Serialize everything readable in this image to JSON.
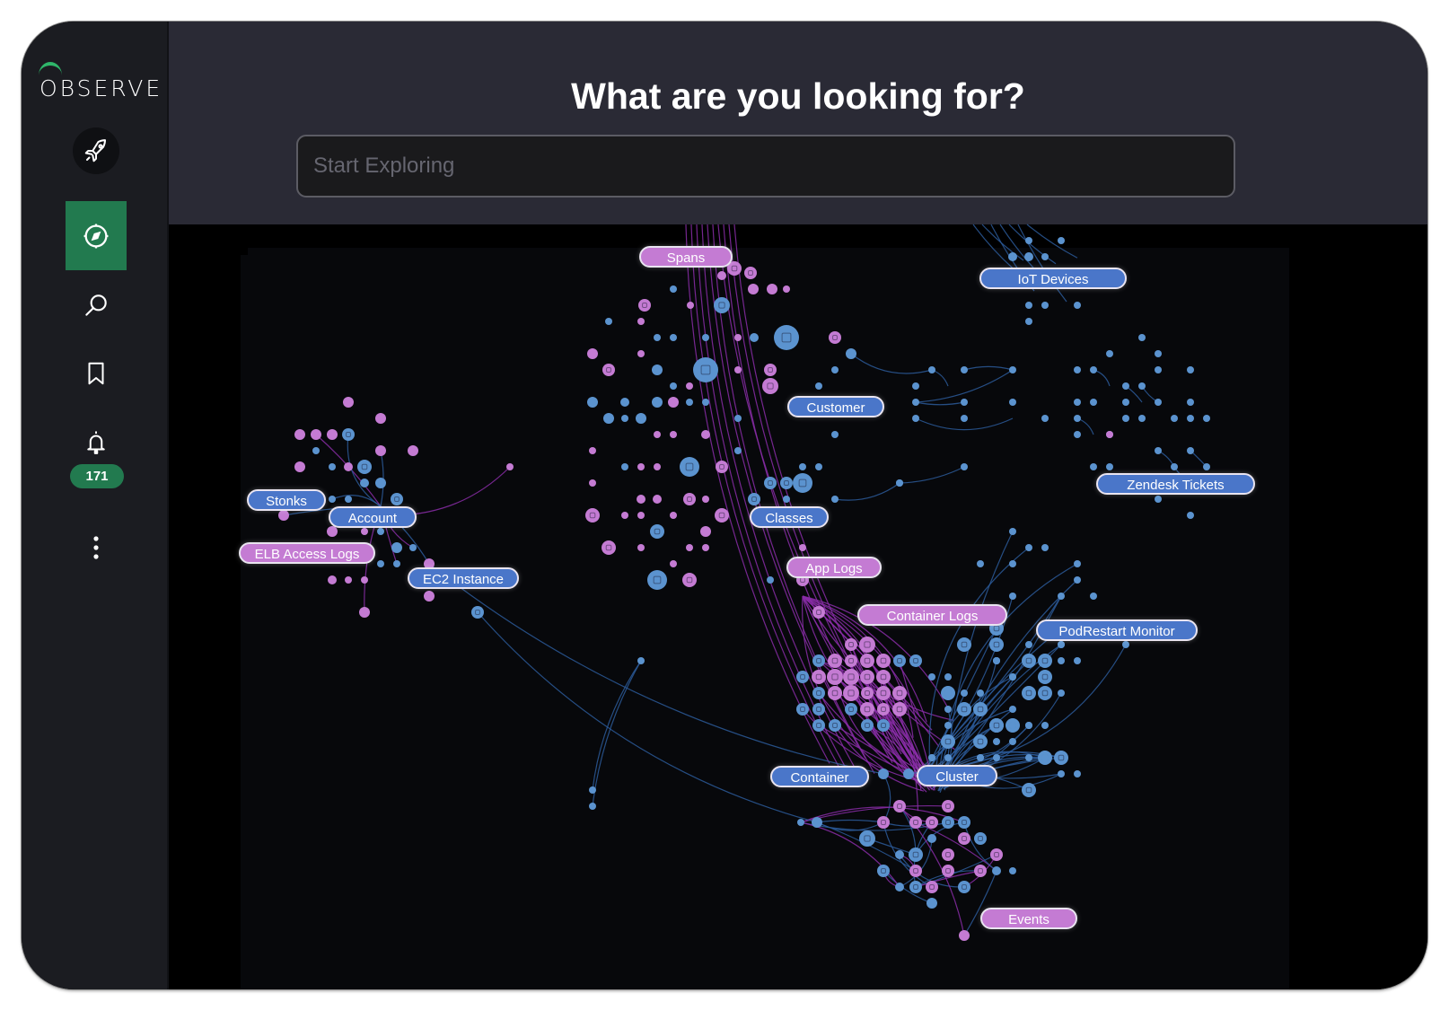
{
  "app": {
    "logo_text": "OBSERVE",
    "accent_color": "#2fb66a"
  },
  "sidebar": {
    "items": [
      {
        "name": "launch",
        "icon": "rocket-icon",
        "active": false
      },
      {
        "name": "explore",
        "icon": "compass-icon",
        "active": true
      },
      {
        "name": "search",
        "icon": "search-icon",
        "active": false
      },
      {
        "name": "bookmarks",
        "icon": "bookmark-icon",
        "active": false
      },
      {
        "name": "alerts",
        "icon": "bell-icon",
        "active": false,
        "badge": "171"
      },
      {
        "name": "more",
        "icon": "more-vertical-icon",
        "active": false
      }
    ],
    "active_color": "#227a4f"
  },
  "header": {
    "title": "What are you looking for?",
    "search_placeholder": "Start Exploring",
    "search_value": ""
  },
  "graph": {
    "colors": {
      "resource": "#5b93cf",
      "event": "#c47bd3",
      "resource_edge": "#2c5a9a",
      "event_edge": "#8a2da8"
    },
    "labels": [
      {
        "text": "Spans",
        "kind": "event"
      },
      {
        "text": "IoT Devices",
        "kind": "resource"
      },
      {
        "text": "Customer",
        "kind": "resource"
      },
      {
        "text": "Zendesk Tickets",
        "kind": "resource"
      },
      {
        "text": "Stonks",
        "kind": "resource"
      },
      {
        "text": "Account",
        "kind": "resource"
      },
      {
        "text": "ELB Access Logs",
        "kind": "event"
      },
      {
        "text": "EC2 Instance",
        "kind": "resource"
      },
      {
        "text": "Classes",
        "kind": "resource"
      },
      {
        "text": "App Logs",
        "kind": "event"
      },
      {
        "text": "Container Logs",
        "kind": "event"
      },
      {
        "text": "PodRestart Monitor",
        "kind": "resource"
      },
      {
        "text": "Container",
        "kind": "resource"
      },
      {
        "text": "Cluster",
        "kind": "resource"
      },
      {
        "text": "Events",
        "kind": "event"
      }
    ]
  }
}
